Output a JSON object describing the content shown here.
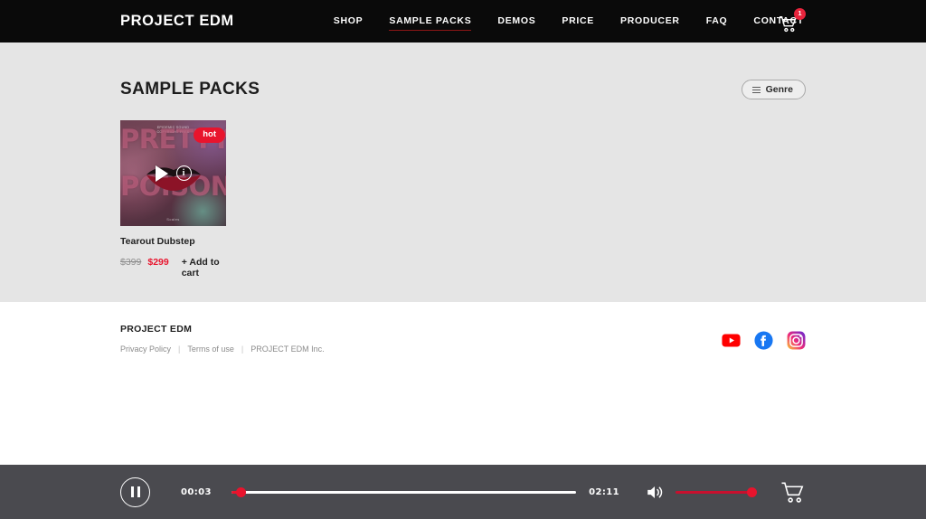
{
  "header": {
    "brand": "PROJECT EDM",
    "nav": [
      {
        "label": "SHOP",
        "active": false
      },
      {
        "label": "SAMPLE PACKS",
        "active": true
      },
      {
        "label": "DEMOS",
        "active": false
      },
      {
        "label": "PRICE",
        "active": false
      },
      {
        "label": "PRODUCER",
        "active": false
      },
      {
        "label": "FAQ",
        "active": false
      },
      {
        "label": "CONTACT",
        "active": false
      }
    ],
    "cart_icon": "shopping-cart-icon",
    "cart_count": "1"
  },
  "main": {
    "title": "SAMPLE PACKS",
    "genre_button": {
      "label": "Genre",
      "icon": "hamburger-icon"
    },
    "products": [
      {
        "title": "Tearout Dubstep",
        "badge": "hot",
        "price_old": "$399",
        "price_new": "$299",
        "add_to_cart": "+ Add to cart",
        "art_title_line1": "PRETTY",
        "art_title_line2": "POISON",
        "art_credit": "EPIDEMIC SOUND\nCOPYRIGHT FREE",
        "art_footer": "Scales",
        "play_icon": "play-icon",
        "info_icon": "info-icon"
      }
    ]
  },
  "footer": {
    "brand": "PROJECT EDM",
    "links": [
      {
        "label": "Privacy Policy"
      },
      {
        "label": "Terms of use"
      },
      {
        "label": "PROJECT EDM Inc."
      }
    ],
    "separator": "|",
    "socials": [
      {
        "name": "youtube-icon",
        "color": "#ff0000"
      },
      {
        "name": "facebook-icon",
        "color": "#1877f2"
      },
      {
        "name": "instagram-icon",
        "color": "#e1306c"
      }
    ]
  },
  "player": {
    "pause_icon": "pause-icon",
    "current_time": "00:03",
    "duration": "02:11",
    "progress_percent": 2,
    "volume_percent": 100,
    "speaker_icon": "speaker-icon",
    "cart_icon": "shopping-cart-icon"
  },
  "colors": {
    "header_bg": "#0a0a0a",
    "content_bg": "#e5e5e5",
    "accent_red": "#e8142d",
    "player_bg": "#4a4a4f",
    "nav_underline": "#8c1616"
  }
}
